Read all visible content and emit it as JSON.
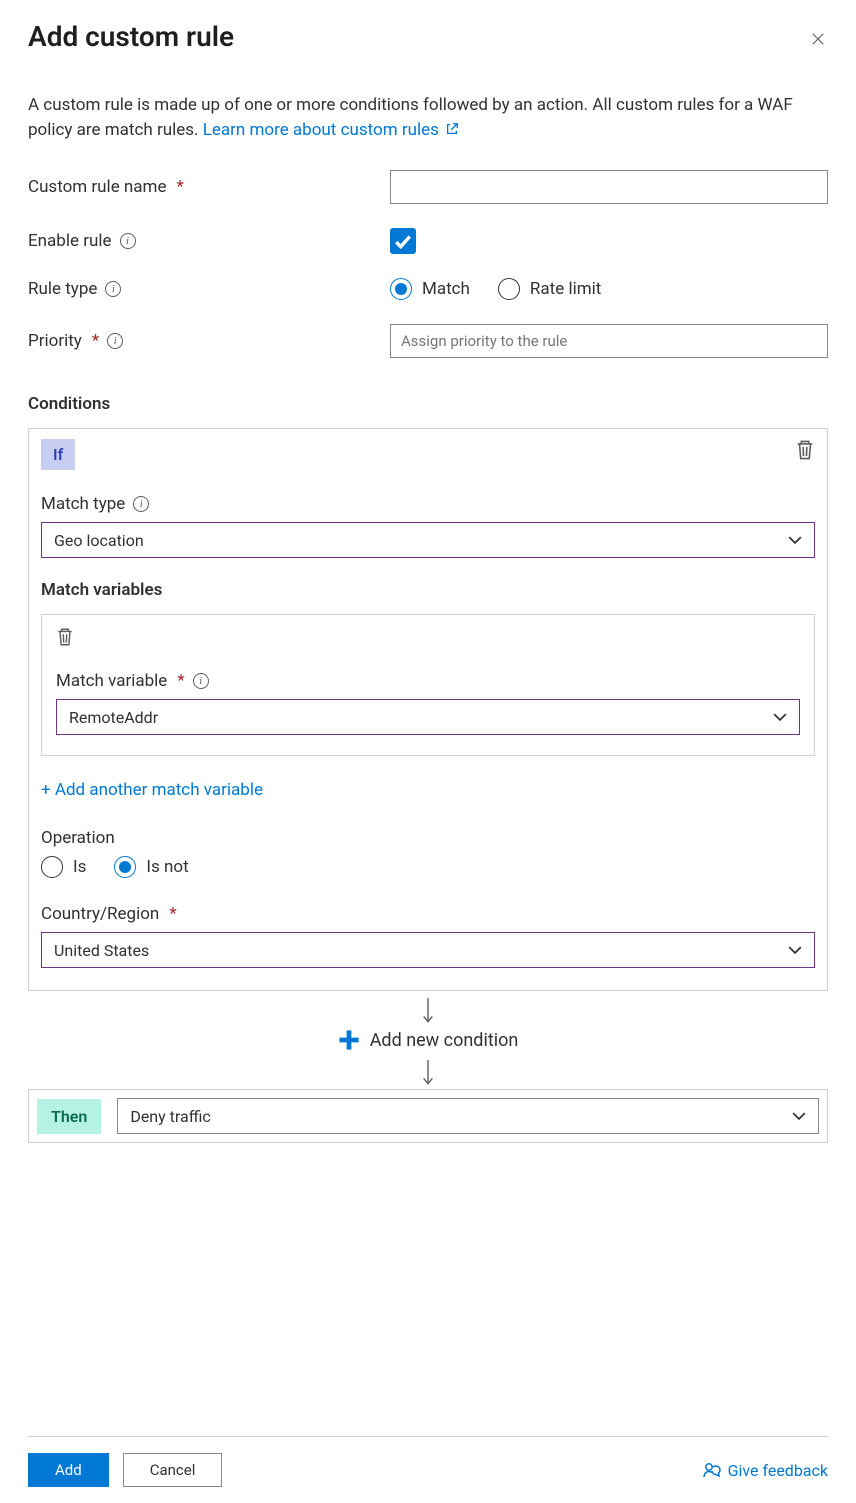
{
  "title": "Add custom rule",
  "intro_text": "A custom rule is made up of one or more conditions followed by an action. All custom rules for a WAF policy are match rules. ",
  "learn_more_text": "Learn more about custom rules",
  "labels": {
    "rule_name": "Custom rule name",
    "enable_rule": "Enable rule",
    "rule_type": "Rule type",
    "priority": "Priority"
  },
  "priority_placeholder": "Assign priority to the rule",
  "rule_type_options": {
    "match": "Match",
    "rate_limit": "Rate limit"
  },
  "conditions_heading": "Conditions",
  "if_badge": "If",
  "match_type_label": "Match type",
  "match_type_value": "Geo location",
  "match_variables_heading": "Match variables",
  "match_variable_label": "Match variable",
  "match_variable_value": "RemoteAddr",
  "add_variable_link": "+ Add another match variable",
  "operation_label": "Operation",
  "operation_options": {
    "is": "Is",
    "is_not": "Is not"
  },
  "country_label": "Country/Region",
  "country_value": "United States",
  "add_condition_text": "Add new condition",
  "then_badge": "Then",
  "then_action_value": "Deny traffic",
  "footer": {
    "add": "Add",
    "cancel": "Cancel",
    "feedback": "Give feedback"
  }
}
